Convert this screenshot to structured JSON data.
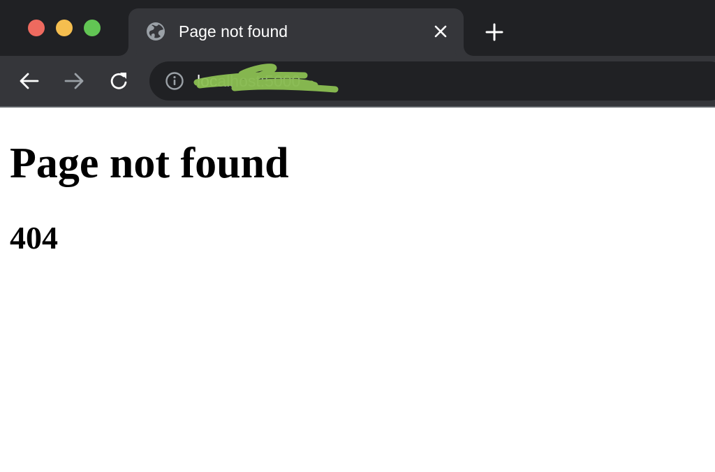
{
  "window": {
    "controls": [
      "close",
      "minimize",
      "maximize"
    ],
    "colors": {
      "close": "#ee6a5f",
      "minimize": "#f5be4f",
      "maximize": "#62c554"
    }
  },
  "tabs": [
    {
      "title": "Page not found",
      "icon": "globe-icon",
      "active": true
    }
  ],
  "toolbar": {
    "back_icon": "arrow-left-icon",
    "forward_icon": "arrow-right-icon",
    "forward_enabled": false,
    "reload_icon": "reload-icon"
  },
  "address_bar": {
    "site_info_icon": "info-icon",
    "url_host": "loc",
    "url_rest": "alhost:5000",
    "redacted": true,
    "redaction_color": "#8bbf52"
  },
  "page": {
    "heading": "Page not found",
    "status_code": "404"
  },
  "colors": {
    "tabstrip_bg": "#202124",
    "toolbar_bg": "#35363a",
    "page_bg": "#ffffff"
  }
}
